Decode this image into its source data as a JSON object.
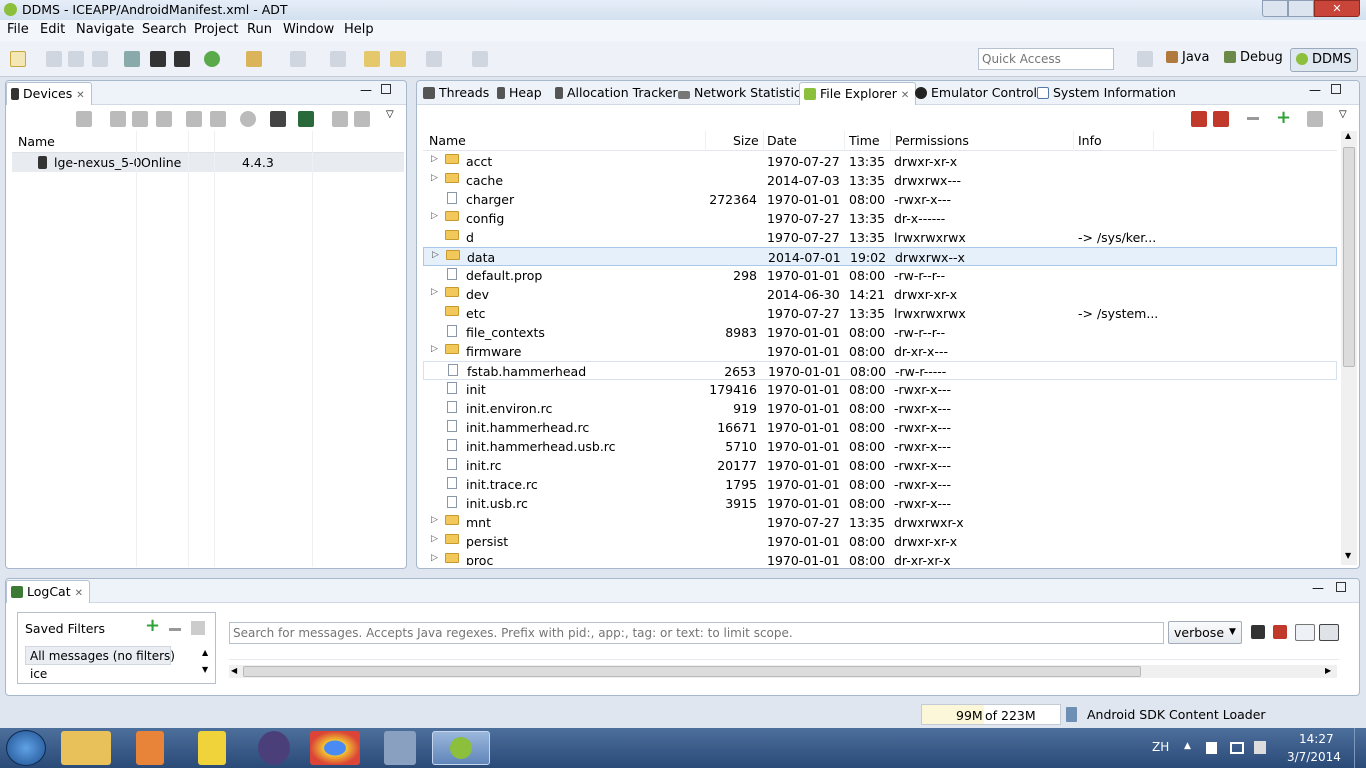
{
  "window": {
    "title": "DDMS - ICEAPP/AndroidManifest.xml - ADT"
  },
  "menu": [
    "File",
    "Edit",
    "Navigate",
    "Search",
    "Project",
    "Run",
    "Window",
    "Help"
  ],
  "toolbar": {
    "quick_access_placeholder": "Quick Access",
    "perspectives": [
      "Java",
      "Debug",
      "DDMS"
    ]
  },
  "devices": {
    "tab_label": "Devices",
    "columns": [
      "Name"
    ],
    "rows": [
      {
        "name": "lge-nexus_5-0",
        "status": "Online",
        "version": "4.4.3"
      }
    ]
  },
  "tabs": [
    "Threads",
    "Heap",
    "Allocation Tracker",
    "Network Statistics",
    "File Explorer",
    "Emulator Control",
    "System Information"
  ],
  "file_explorer": {
    "columns": [
      "Name",
      "Size",
      "Date",
      "Time",
      "Permissions",
      "Info"
    ],
    "rows": [
      {
        "type": "folder",
        "name": "acct",
        "size": "",
        "date": "1970-07-27",
        "time": "13:35",
        "perm": "drwxr-xr-x",
        "info": ""
      },
      {
        "type": "folder",
        "name": "cache",
        "size": "",
        "date": "2014-07-03",
        "time": "13:35",
        "perm": "drwxrwx---",
        "info": ""
      },
      {
        "type": "file",
        "name": "charger",
        "size": "272364",
        "date": "1970-01-01",
        "time": "08:00",
        "perm": "-rwxr-x---",
        "info": ""
      },
      {
        "type": "folder",
        "name": "config",
        "size": "",
        "date": "1970-07-27",
        "time": "13:35",
        "perm": "dr-x------",
        "info": ""
      },
      {
        "type": "folder-link",
        "name": "d",
        "size": "",
        "date": "1970-07-27",
        "time": "13:35",
        "perm": "lrwxrwxrwx",
        "info": "-> /sys/ker..."
      },
      {
        "type": "folder",
        "name": "data",
        "size": "",
        "date": "2014-07-01",
        "time": "19:02",
        "perm": "drwxrwx--x",
        "info": "",
        "selected": true
      },
      {
        "type": "file",
        "name": "default.prop",
        "size": "298",
        "date": "1970-01-01",
        "time": "08:00",
        "perm": "-rw-r--r--",
        "info": ""
      },
      {
        "type": "folder",
        "name": "dev",
        "size": "",
        "date": "2014-06-30",
        "time": "14:21",
        "perm": "drwxr-xr-x",
        "info": ""
      },
      {
        "type": "folder-link",
        "name": "etc",
        "size": "",
        "date": "1970-07-27",
        "time": "13:35",
        "perm": "lrwxrwxrwx",
        "info": "-> /system..."
      },
      {
        "type": "file",
        "name": "file_contexts",
        "size": "8983",
        "date": "1970-01-01",
        "time": "08:00",
        "perm": "-rw-r--r--",
        "info": ""
      },
      {
        "type": "folder",
        "name": "firmware",
        "size": "",
        "date": "1970-01-01",
        "time": "08:00",
        "perm": "dr-xr-x---",
        "info": ""
      },
      {
        "type": "file",
        "name": "fstab.hammerhead",
        "size": "2653",
        "date": "1970-01-01",
        "time": "08:00",
        "perm": "-rw-r-----",
        "info": "",
        "hover": true
      },
      {
        "type": "file",
        "name": "init",
        "size": "179416",
        "date": "1970-01-01",
        "time": "08:00",
        "perm": "-rwxr-x---",
        "info": ""
      },
      {
        "type": "file",
        "name": "init.environ.rc",
        "size": "919",
        "date": "1970-01-01",
        "time": "08:00",
        "perm": "-rwxr-x---",
        "info": ""
      },
      {
        "type": "file",
        "name": "init.hammerhead.rc",
        "size": "16671",
        "date": "1970-01-01",
        "time": "08:00",
        "perm": "-rwxr-x---",
        "info": ""
      },
      {
        "type": "file",
        "name": "init.hammerhead.usb.rc",
        "size": "5710",
        "date": "1970-01-01",
        "time": "08:00",
        "perm": "-rwxr-x---",
        "info": ""
      },
      {
        "type": "file",
        "name": "init.rc",
        "size": "20177",
        "date": "1970-01-01",
        "time": "08:00",
        "perm": "-rwxr-x---",
        "info": ""
      },
      {
        "type": "file",
        "name": "init.trace.rc",
        "size": "1795",
        "date": "1970-01-01",
        "time": "08:00",
        "perm": "-rwxr-x---",
        "info": ""
      },
      {
        "type": "file",
        "name": "init.usb.rc",
        "size": "3915",
        "date": "1970-01-01",
        "time": "08:00",
        "perm": "-rwxr-x---",
        "info": ""
      },
      {
        "type": "folder",
        "name": "mnt",
        "size": "",
        "date": "1970-07-27",
        "time": "13:35",
        "perm": "drwxrwxr-x",
        "info": ""
      },
      {
        "type": "folder",
        "name": "persist",
        "size": "",
        "date": "1970-01-01",
        "time": "08:00",
        "perm": "drwxr-xr-x",
        "info": ""
      },
      {
        "type": "folder",
        "name": "proc",
        "size": "",
        "date": "1970-01-01",
        "time": "08:00",
        "perm": "dr-xr-xr-x",
        "info": ""
      }
    ]
  },
  "logcat": {
    "tab_label": "LogCat",
    "saved_filters_label": "Saved Filters",
    "filters": [
      "All messages (no filters)",
      "ice"
    ],
    "search_placeholder": "Search for messages. Accepts Java regexes. Prefix with pid:, app:, tag: or text: to limit scope.",
    "level": "verbose"
  },
  "status": {
    "heap_used": "99M",
    "heap_total": "of 223M",
    "loader": "Android SDK Content Loader"
  },
  "tray": {
    "lang": "ZH",
    "time": "14:27",
    "date": "3/7/2014"
  },
  "colors": {
    "selected_row": "#e5f0fb",
    "selected_border": "#a9c8ea",
    "folder": "#f2c85b",
    "taskbar": "#2a4a78"
  }
}
